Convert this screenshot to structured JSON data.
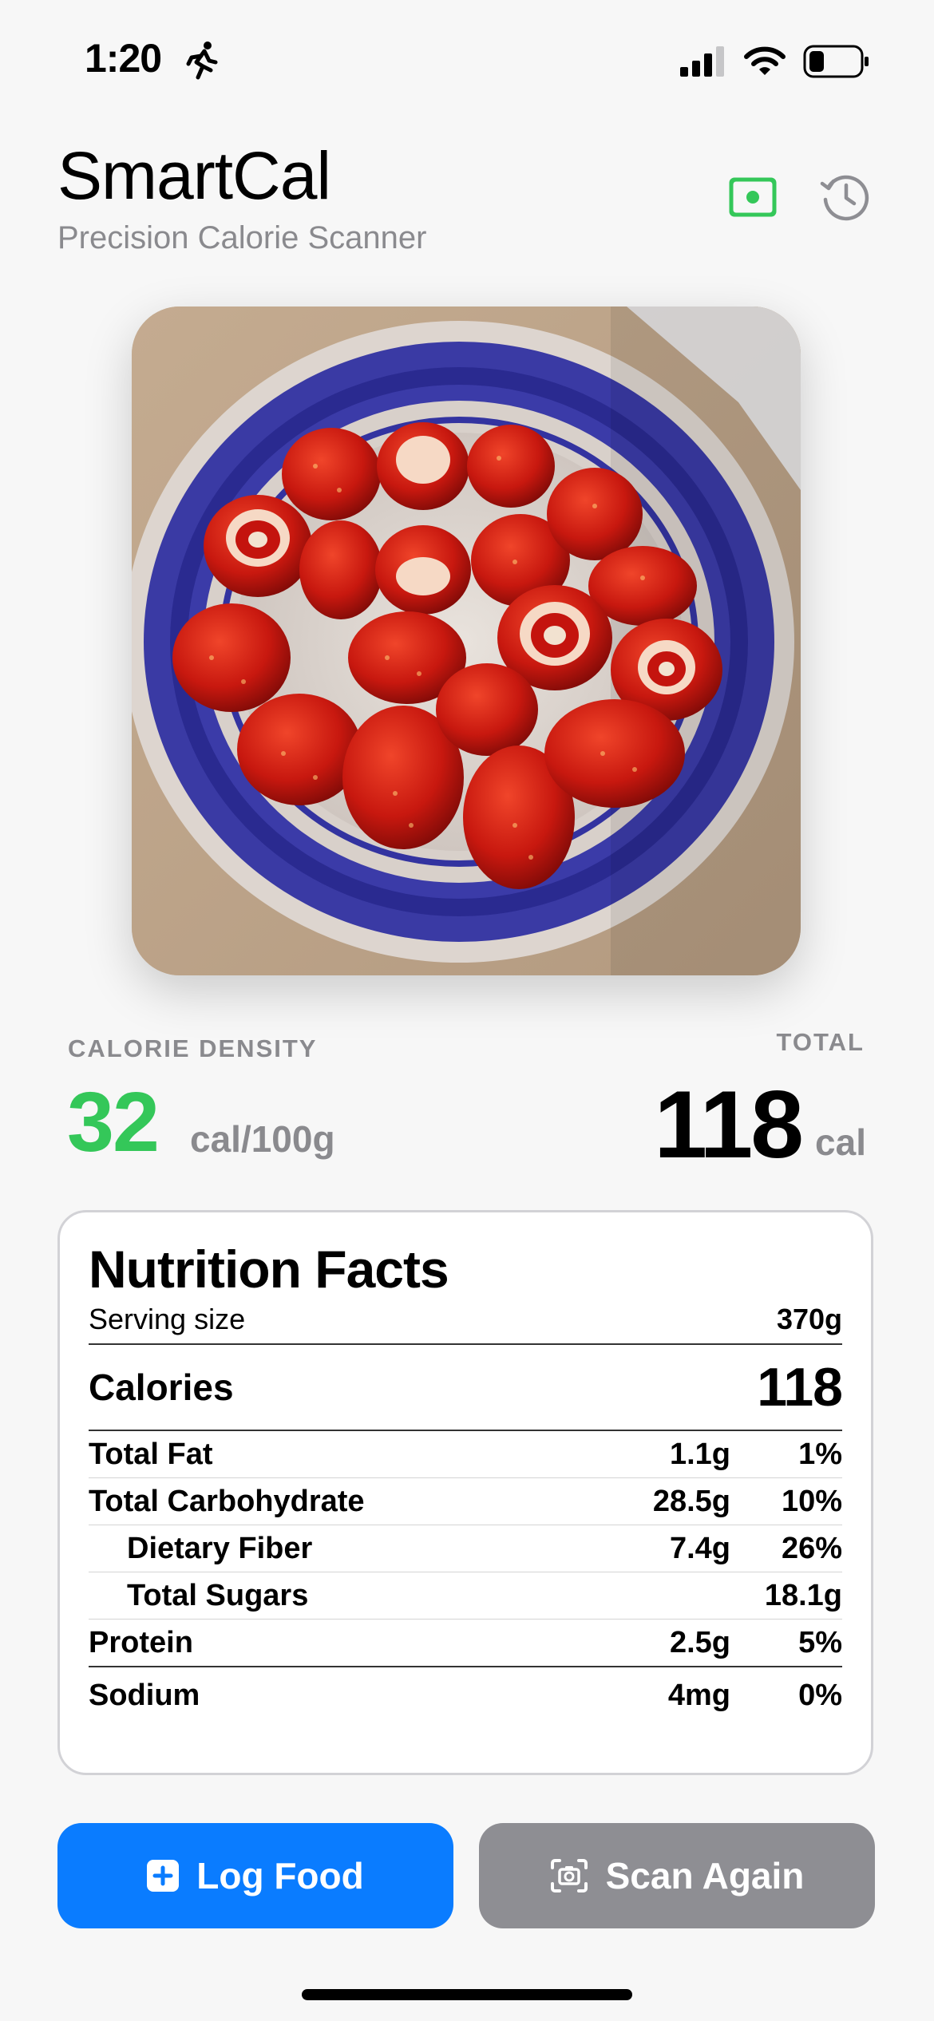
{
  "status_bar": {
    "time": "1:20"
  },
  "header": {
    "title": "SmartCal",
    "subtitle": "Precision Calorie Scanner",
    "accent_color": "#34c759",
    "icons": [
      "camera-scan-icon",
      "history-icon"
    ]
  },
  "photo": {
    "icon": "strawberries-in-bowl-photo"
  },
  "summary": {
    "density_label": "CALORIE DENSITY",
    "density_value": "32",
    "density_unit": "cal/100g",
    "total_label": "TOTAL",
    "total_value": "118",
    "total_unit": "cal"
  },
  "nutrition": {
    "title": "Nutrition Facts",
    "serving_label": "Serving size",
    "serving_value": "370g",
    "calories_label": "Calories",
    "calories_value": "118",
    "rows": [
      {
        "label": "Total Fat",
        "amount": "1.1g",
        "percent": "1%"
      },
      {
        "label": "Total Carbohydrate",
        "amount": "28.5g",
        "percent": "10%"
      },
      {
        "label": "Dietary Fiber",
        "amount": "7.4g",
        "percent": "26%"
      },
      {
        "label": "Total Sugars",
        "amount": "",
        "percent": "18.1g"
      },
      {
        "label": "Protein",
        "amount": "2.5g",
        "percent": "5%"
      },
      {
        "label": "Sodium",
        "amount": "4mg",
        "percent": "0%"
      }
    ]
  },
  "actions": {
    "log_label": "Log Food",
    "scan_label": "Scan Again",
    "log_color": "#0a7cff",
    "scan_color": "#8e8e93"
  }
}
